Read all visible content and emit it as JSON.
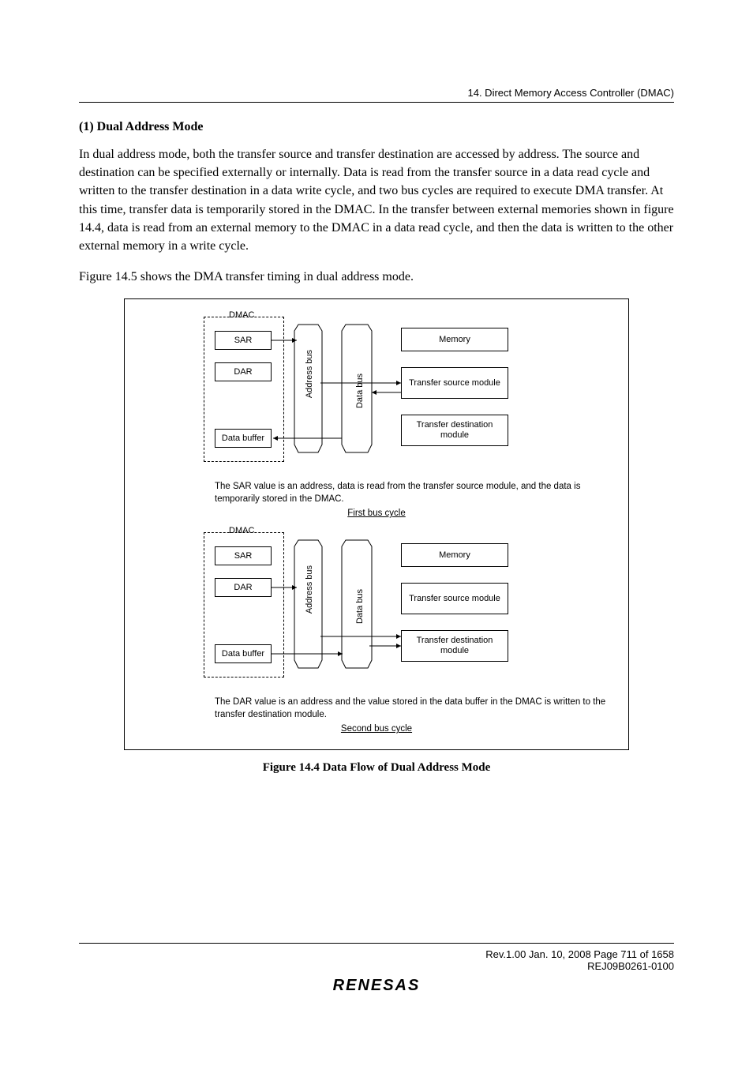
{
  "header": {
    "title": "14.   Direct Memory Access Controller (DMAC)"
  },
  "section": {
    "title": "(1)    Dual Address Mode"
  },
  "para1": "In dual address mode, both the transfer source and transfer destination are accessed by address. The source and destination can be specified externally or internally. Data is read from the transfer source in a data read cycle and written to the transfer destination in a data write cycle, and two bus cycles are required to execute DMA transfer. At this time, transfer data is temporarily stored in the DMAC. In the transfer between external memories shown in figure 14.4, data is read from an external memory to the DMAC in a data read cycle, and then the data is written to the other external memory in a write cycle.",
  "para2": "Figure 14.5 shows the DMA transfer timing in dual address mode.",
  "diagram": {
    "dmac": "DMAC",
    "sar": "SAR",
    "dar": "DAR",
    "databuffer": "Data buffer",
    "addrbus": "Address bus",
    "databus": "Data bus",
    "memory": "Memory",
    "tsrc": "Transfer source module",
    "tdst": "Transfer destination module",
    "desc1": "The SAR value is an address, data is read from the transfer source module, and the data is temporarily stored in the DMAC.",
    "cycle1": "First bus cycle",
    "desc2": "The DAR value is an address and the value stored in the data buffer in the DMAC is written to the transfer destination module.",
    "cycle2": "Second bus cycle"
  },
  "figureCaption": "Figure 14.4   Data Flow of Dual Address Mode",
  "footer": {
    "rev": "Rev.1.00  Jan. 10, 2008  Page 711 of 1658",
    "doc": "REJ09B0261-0100",
    "logo": "RENESAS"
  }
}
